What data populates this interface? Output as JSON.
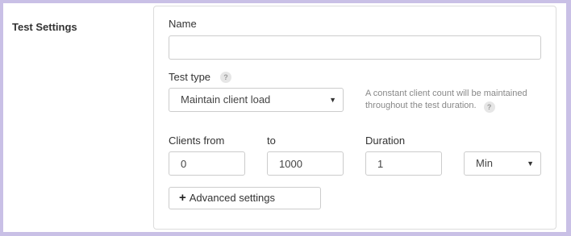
{
  "section": {
    "title": "Test Settings"
  },
  "form": {
    "name_label": "Name",
    "name_value": "",
    "test_type_label": "Test type",
    "test_type_help": "?",
    "test_type_selected": "Maintain client load",
    "test_type_hint": "A constant client count will be maintained throughout the test duration.",
    "hint_help": "?",
    "clients_from_label": "Clients from",
    "clients_from_value": "0",
    "to_label": "to",
    "to_value": "1000",
    "duration_label": "Duration",
    "duration_value": "1",
    "duration_unit_selected": "Min",
    "advanced_plus": "+",
    "advanced_label": "Advanced settings"
  },
  "icons": {
    "caret": "caret-down-icon",
    "help": "question-mark-icon",
    "plus": "plus-icon"
  }
}
